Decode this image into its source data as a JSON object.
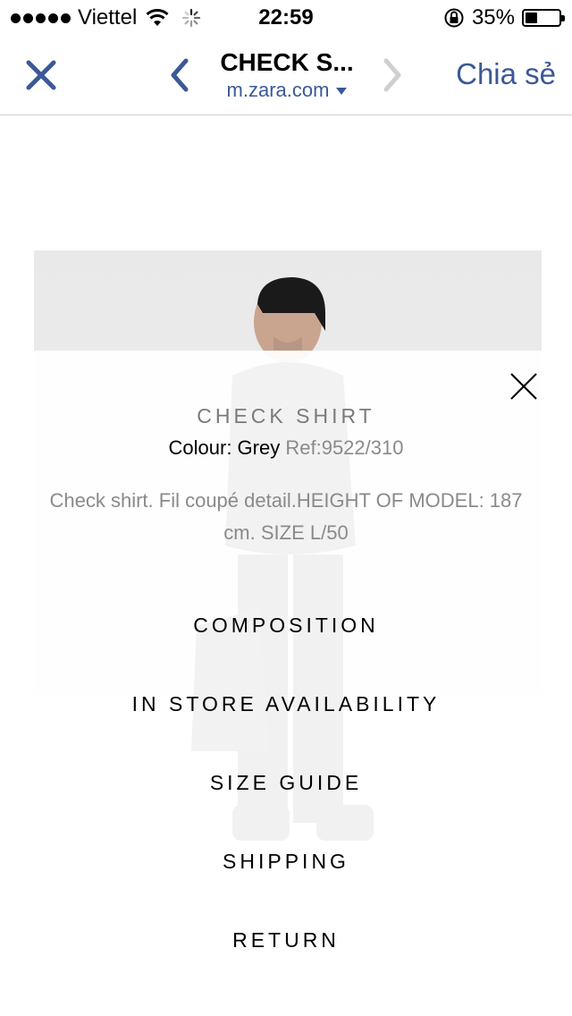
{
  "status_bar": {
    "carrier": "Viettel",
    "time": "22:59",
    "battery_percent": "35%",
    "battery_level": 0.35
  },
  "nav": {
    "title": "CHECK S...",
    "url": "m.zara.com",
    "share_label": "Chia sẻ",
    "accent_color": "#3b5998"
  },
  "product": {
    "name": "CHECK SHIRT",
    "colour_text": "Colour: Grey",
    "ref_text": "Ref:9522/310",
    "description": "Check shirt. Fil coupé detail.HEIGHT OF MODEL: 187 cm. SIZE L/50"
  },
  "menu": {
    "items": [
      {
        "label": "COMPOSITION"
      },
      {
        "label": "IN STORE AVAILABILITY"
      },
      {
        "label": "SIZE GUIDE"
      },
      {
        "label": "SHIPPING"
      },
      {
        "label": "RETURN"
      }
    ]
  }
}
